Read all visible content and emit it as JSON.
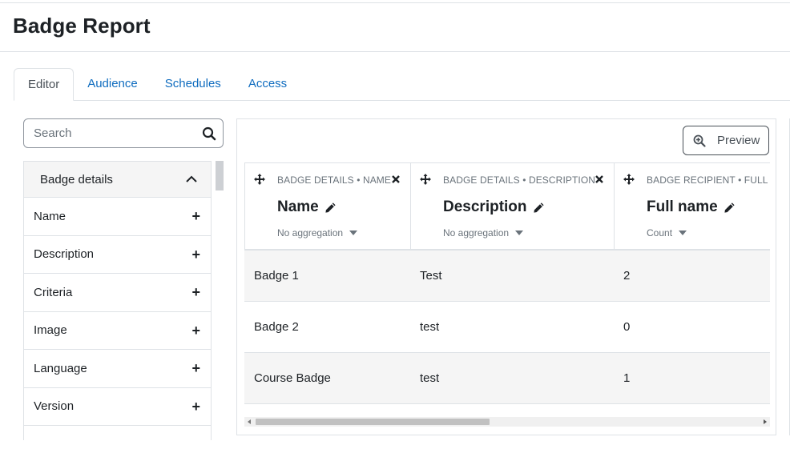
{
  "page": {
    "title": "Badge Report"
  },
  "tabs": [
    {
      "label": "Editor",
      "active": true
    },
    {
      "label": "Audience",
      "active": false
    },
    {
      "label": "Schedules",
      "active": false
    },
    {
      "label": "Access",
      "active": false
    }
  ],
  "search": {
    "placeholder": "Search",
    "value": ""
  },
  "sidebar": {
    "group_label": "Badge details",
    "items": [
      {
        "label": "Name"
      },
      {
        "label": "Description"
      },
      {
        "label": "Criteria"
      },
      {
        "label": "Image"
      },
      {
        "label": "Language"
      },
      {
        "label": "Version"
      }
    ]
  },
  "preview": {
    "label": "Preview"
  },
  "columns": [
    {
      "meta": "Badge details • Name",
      "title": "Name",
      "aggregation": "No aggregation"
    },
    {
      "meta": "Badge details • Description",
      "title": "Description",
      "aggregation": "No aggregation"
    },
    {
      "meta": "Badge recipient • Full name",
      "title": "Full name",
      "aggregation": "Count"
    }
  ],
  "rows": [
    {
      "name": "Badge 1",
      "description": "Test",
      "count": "2"
    },
    {
      "name": "Badge 2",
      "description": "test",
      "count": "0"
    },
    {
      "name": "Course Badge",
      "description": "test",
      "count": "1"
    }
  ],
  "colors": {
    "link": "#0f6cbf",
    "text": "#1d2125",
    "muted": "#6a737b",
    "border": "#dee2e6"
  }
}
